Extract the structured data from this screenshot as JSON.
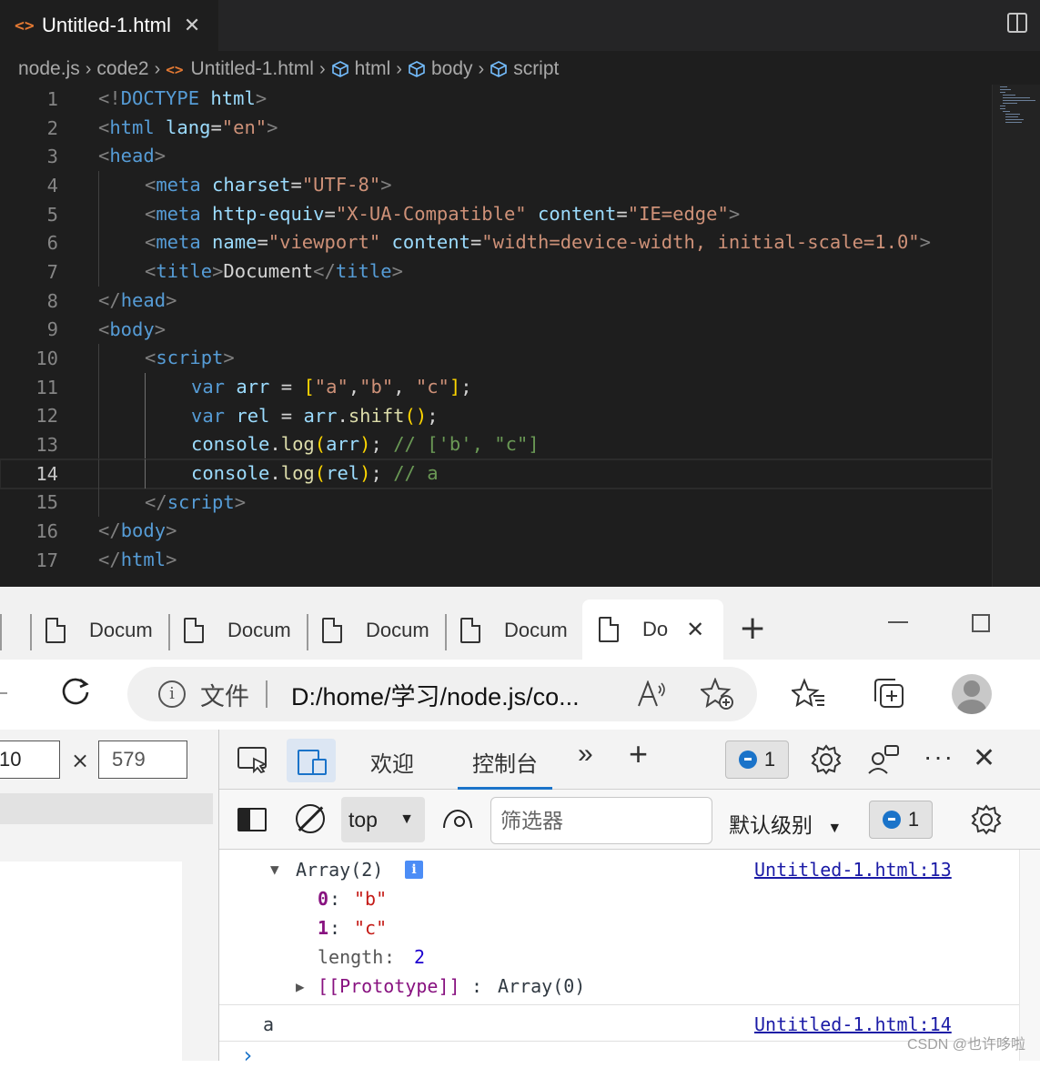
{
  "editor": {
    "tab": {
      "icon": "html-file-icon",
      "label": "Untitled-1.html",
      "close": "✕"
    },
    "breadcrumb": {
      "items": [
        "node.js",
        "code2",
        "Untitled-1.html",
        "html",
        "body",
        "script"
      ]
    },
    "current_line": 14,
    "lines": [
      {
        "n": "1"
      },
      {
        "n": "2"
      },
      {
        "n": "3"
      },
      {
        "n": "4"
      },
      {
        "n": "5"
      },
      {
        "n": "6"
      },
      {
        "n": "7"
      },
      {
        "n": "8"
      },
      {
        "n": "9"
      },
      {
        "n": "10"
      },
      {
        "n": "11"
      },
      {
        "n": "12"
      },
      {
        "n": "13"
      },
      {
        "n": "14"
      },
      {
        "n": "15"
      },
      {
        "n": "16"
      },
      {
        "n": "17"
      }
    ],
    "code_text": {
      "l1": [
        "<!",
        "DOCTYPE",
        " html",
        ">"
      ],
      "l2": [
        "<",
        "html",
        " lang",
        "=",
        "\"en\"",
        ">"
      ],
      "l3": [
        "<",
        "head",
        ">"
      ],
      "l4": [
        "<",
        "meta",
        " charset",
        "=",
        "\"UTF-8\"",
        ">"
      ],
      "l5": [
        "<",
        "meta",
        " http-equiv",
        "=",
        "\"X-UA-Compatible\"",
        " content",
        "=",
        "\"IE=edge\"",
        ">"
      ],
      "l6": [
        "<",
        "meta",
        " name",
        "=",
        "\"viewport\"",
        " content",
        "=",
        "\"width=device-width, initial-scale=1.0\"",
        ">"
      ],
      "l7": [
        "<",
        "title",
        ">",
        "Document",
        "</",
        "title",
        ">"
      ],
      "l8": [
        "</",
        "head",
        ">"
      ],
      "l9": [
        "<",
        "body",
        ">"
      ],
      "l10": [
        "<",
        "script",
        ">"
      ],
      "l11": [
        "var",
        " arr",
        " = ",
        "[",
        "\"a\"",
        ",",
        "\"b\"",
        ", ",
        "\"c\"",
        "]",
        ";"
      ],
      "l12": [
        "var",
        " rel",
        " = ",
        "arr",
        ".",
        "shift",
        "(",
        ")",
        ";"
      ],
      "l13": [
        "console",
        ".",
        "log",
        "(",
        "arr",
        ")",
        "; ",
        "// ['b', \"c\"]"
      ],
      "l14": [
        "console",
        ".",
        "log",
        "(",
        "rel",
        ")",
        "; ",
        "// a"
      ],
      "l15": [
        "</",
        "script",
        ">"
      ],
      "l16": [
        "</",
        "body",
        ">"
      ],
      "l17": [
        "</",
        "html",
        ">"
      ]
    }
  },
  "browser": {
    "tabs": [
      {
        "label": "Docum"
      },
      {
        "label": "Docum"
      },
      {
        "label": "Docum"
      },
      {
        "label": "Docum"
      }
    ],
    "active_tab": {
      "label": "Do",
      "close": "✕"
    },
    "new_tab": "+",
    "address": {
      "info": "i",
      "file_label": "文件",
      "url": "D:/home/学习/node.js/co..."
    },
    "device": {
      "width": "10",
      "times": "×",
      "height": "579"
    }
  },
  "devtools": {
    "tabs": {
      "welcome": "欢迎",
      "console": "控制台",
      "more": "»",
      "add": "+"
    },
    "issues_count": "1",
    "toolbar": {
      "context": "top",
      "filter_placeholder": "筛选器",
      "level": "默认级别",
      "issues_count": "1"
    },
    "console": {
      "array_header": "Array(2)",
      "info_badge": "i",
      "source1": "Untitled-1.html:13",
      "items": [
        {
          "key": "0",
          "value": "\"b\""
        },
        {
          "key": "1",
          "value": "\"c\""
        }
      ],
      "length_key": "length",
      "length_value": "2",
      "prototype_key": "[[Prototype]]",
      "prototype_value": "Array(0)",
      "log2_value": "a",
      "source2": "Untitled-1.html:14",
      "prompt": "›"
    }
  },
  "watermark": "CSDN @也许哆啦",
  "colors": {
    "editor_bg": "#1e1e1e",
    "tag": "#569cd6",
    "attr": "#9cdcfe",
    "string": "#ce9178",
    "comment": "#6a9955",
    "function": "#dcdcaa",
    "bracket_gold": "#ffd700",
    "bracket_purple": "#da70d6",
    "console_key": "#881280",
    "console_string": "#c41a16",
    "accent_blue": "#1a73c9"
  }
}
